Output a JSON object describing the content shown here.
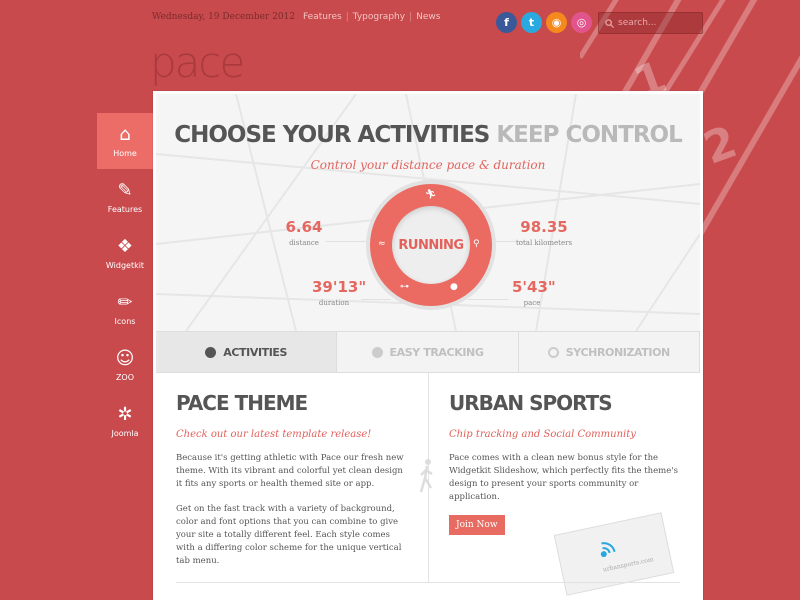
{
  "topbar": {
    "date": "Wednesday, 19 December 2012",
    "links": [
      "Features",
      "Typography",
      "News"
    ]
  },
  "social": [
    {
      "name": "facebook-icon",
      "glyph": "f",
      "color": "#3b5998"
    },
    {
      "name": "twitter-icon",
      "glyph": "t",
      "color": "#2aa9e0"
    },
    {
      "name": "rss-icon",
      "glyph": "◉",
      "color": "#f5891d"
    },
    {
      "name": "dribbble-icon",
      "glyph": "◎",
      "color": "#e2548c"
    }
  ],
  "search": {
    "placeholder": "search..."
  },
  "logo": "pace",
  "track_numbers": [
    "1",
    "2"
  ],
  "sidenav": [
    {
      "label": "Home",
      "icon": "home-icon",
      "glyph": "⌂",
      "active": true
    },
    {
      "label": "Features",
      "icon": "wrench-icon",
      "glyph": "✎",
      "active": false
    },
    {
      "label": "Widgetkit",
      "icon": "widgetkit-icon",
      "glyph": "❖",
      "active": false
    },
    {
      "label": "Icons",
      "icon": "pencil-icon",
      "glyph": "✏",
      "active": false
    },
    {
      "label": "ZOO",
      "icon": "zoo-icon",
      "glyph": "☺",
      "active": false
    },
    {
      "label": "Joomla",
      "icon": "joomla-icon",
      "glyph": "✲",
      "active": false
    }
  ],
  "hero": {
    "title_bold": "CHOOSE YOUR ACTIVITIES",
    "title_light": "KEEP CONTROL",
    "subtitle": "Control your distance pace & duration",
    "center_label": "RUNNING",
    "stats": {
      "distance": {
        "value": "6.64",
        "label": "distance"
      },
      "total": {
        "value": "98.35",
        "label": "total kilometers"
      },
      "duration": {
        "value": "39'13\"",
        "label": "duration"
      },
      "pace": {
        "value": "5'43\"",
        "label": "pace"
      }
    }
  },
  "tabs": [
    {
      "label": "ACTIVITIES",
      "active": true,
      "icon": "play-icon"
    },
    {
      "label": "EASY TRACKING",
      "active": false,
      "icon": "globe-icon"
    },
    {
      "label": "SYCHRONIZATION",
      "active": false,
      "icon": "refresh-icon"
    }
  ],
  "left": {
    "title": "PACE THEME",
    "tagline": "Check out our latest template release!",
    "p1": "Because it's getting athletic with Pace our fresh new theme. With its vibrant and colorful yet clean design it fits any sports or health themed site or app.",
    "p2": "Get on the fast track with a variety of background, color and font options that you can combine to give your site a totally different feel. Each style comes with a differing color scheme for the unique vertical tab menu."
  },
  "right": {
    "title": "URBAN SPORTS",
    "tagline": "Chip tracking and Social Community",
    "p1": "Pace comes with a clean new bonus style for the Widgetkit Slideshow, which perfectly fits the theme's design to present your sports community or application.",
    "button": "Join Now",
    "card_label": "urbansports.com"
  },
  "colors": {
    "accent": "#e86b61",
    "background": "#c94a4d"
  }
}
